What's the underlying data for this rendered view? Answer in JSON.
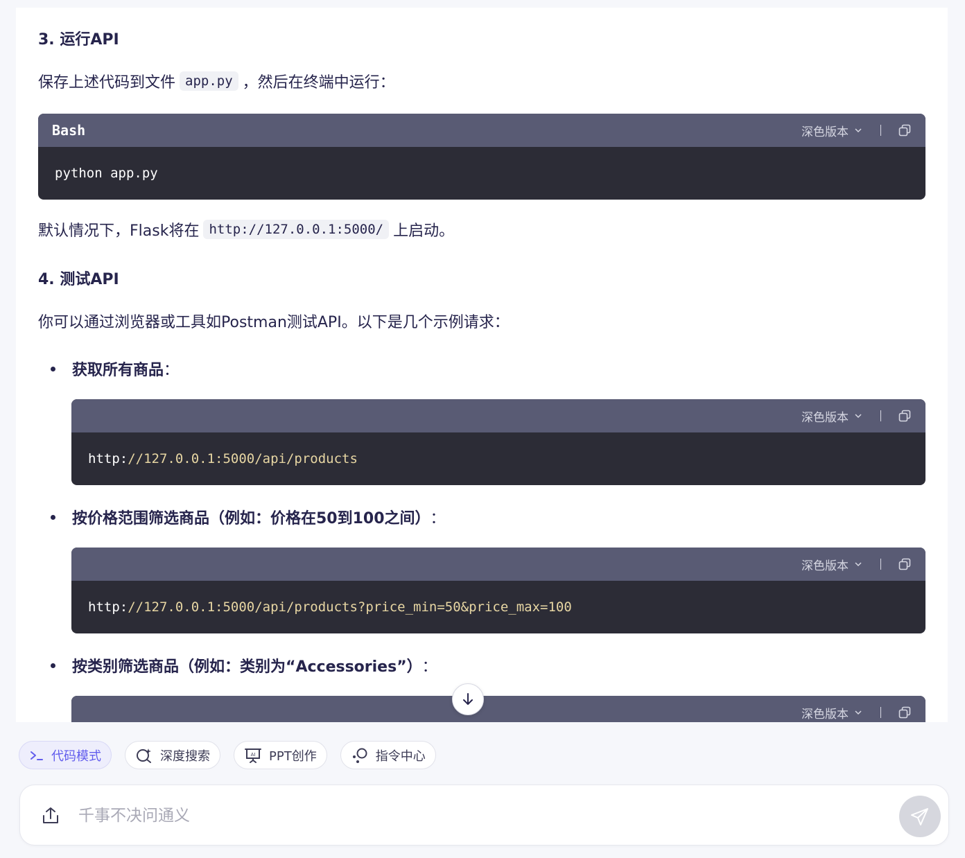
{
  "content": {
    "section3_title": "3. 运行API",
    "section3_text_before": "保存上述代码到文件",
    "section3_code_inline": "app.py",
    "section3_text_after": "，然后在终端中运行：",
    "run_block": {
      "lang": "Bash",
      "theme_label": "深色版本",
      "code": "python app.py"
    },
    "default_text_before": "默认情况下，Flask将在",
    "default_code_inline": "http://127.0.0.1:5000/",
    "default_text_after": "上启动。",
    "section4_title": "4. 测试API",
    "section4_intro": "你可以通过浏览器或工具如Postman测试API。以下是几个示例请求：",
    "examples": [
      {
        "label": "获取所有商品",
        "suffix": "：",
        "theme_label": "深色版本",
        "code_scheme": "http:",
        "code_rest": "//127.0.0.1:5000/api/products"
      },
      {
        "label": "按价格范围筛选商品（例如：价格在50到100之间）",
        "suffix": "：",
        "theme_label": "深色版本",
        "code_scheme": "http:",
        "code_rest": "//127.0.0.1:5000/api/products?price_min=50&price_max=100"
      },
      {
        "label": "按类别筛选商品（例如：类别为“Accessories”）",
        "suffix": "：",
        "theme_label": "深色版本"
      }
    ]
  },
  "toolbar": {
    "chips": [
      {
        "label": "代码模式",
        "icon": "terminal-icon",
        "active": true
      },
      {
        "label": "深度搜索",
        "icon": "search-sparkle-icon",
        "active": false
      },
      {
        "label": "PPT创作",
        "icon": "presentation-icon",
        "active": false
      },
      {
        "label": "指令中心",
        "icon": "command-center-icon",
        "active": false
      }
    ]
  },
  "input": {
    "placeholder": "千事不决问通义"
  },
  "colors": {
    "accent": "#615ced",
    "code_header": "#595b74",
    "code_bg": "#2c2c36",
    "string": "#e7d6a3"
  }
}
